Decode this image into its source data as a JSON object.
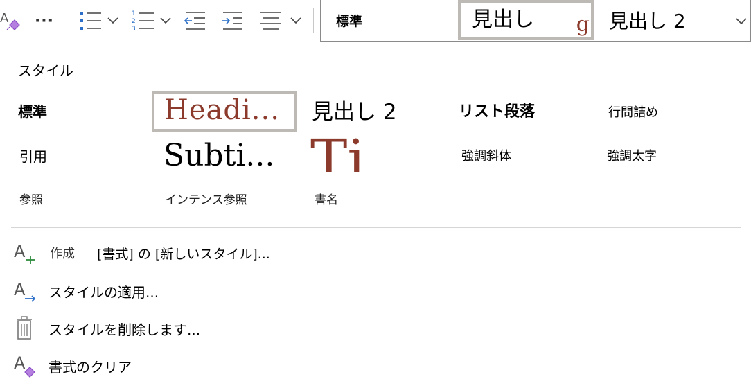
{
  "toolbar": {
    "more_label": "···"
  },
  "gallery": {
    "items": [
      {
        "label": "標準"
      },
      {
        "label": "見出し"
      },
      {
        "label": "見出し 2"
      }
    ]
  },
  "panel": {
    "title": "スタイル",
    "styles": [
      {
        "label": "標準"
      },
      {
        "label": "Headi..."
      },
      {
        "label": "見出し 2"
      },
      {
        "label": "リスト段落"
      },
      {
        "label": "行間詰め"
      },
      {
        "label": "引用"
      },
      {
        "label": "Subti..."
      },
      {
        "label": "Ti..."
      },
      {
        "label": "強調斜体"
      },
      {
        "label": "強調太字"
      },
      {
        "label": "参照"
      },
      {
        "label": "インテンス参照"
      },
      {
        "label": "書名"
      }
    ],
    "actions": {
      "create_label": "作成",
      "create_detail": "[書式] の [新しいスタイル]...",
      "apply_label": "スタイルの適用...",
      "delete_label": "スタイルを削除します...",
      "clear_label": "書式のクリア"
    }
  },
  "colors": {
    "heading_red": "#8b3a2b",
    "selected_border": "#bdbab6",
    "icon_blue": "#2b6fc9",
    "icon_green": "#2e8b3c",
    "icon_purple": "#8a4fc4",
    "icon_gray": "#555555"
  }
}
